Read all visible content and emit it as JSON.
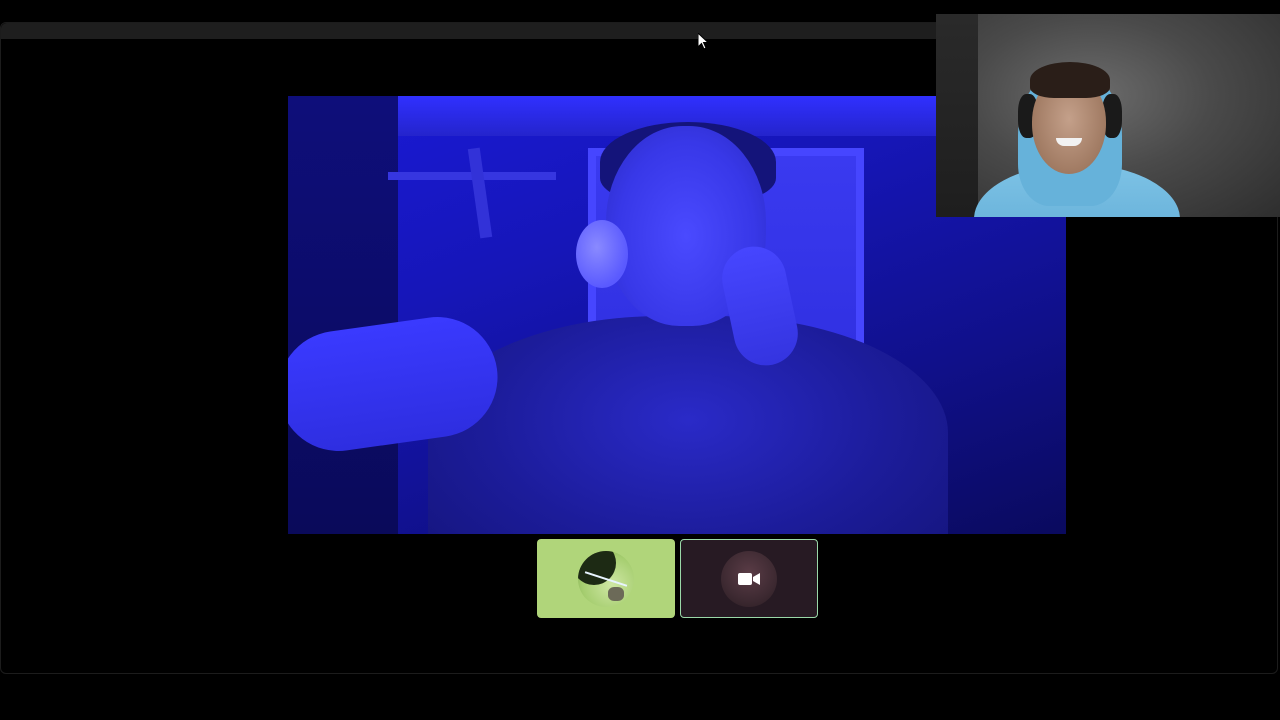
{
  "window": {
    "title": ""
  },
  "call": {
    "main_video": {
      "description_icon": "camera-feed"
    },
    "self_view": {
      "icon": "self-camera-feed"
    },
    "participants": [
      {
        "avatar_color": "#b0d57a",
        "icon": "avatar-image"
      },
      {
        "avatar_color": "#271a23",
        "icon": "video-camera-icon",
        "highlight_border": "#9ad8a8"
      }
    ]
  },
  "colors": {
    "background": "#000000",
    "tile_active_border": "#9ad8a8",
    "main_video_tint": "#1a1ad8"
  }
}
